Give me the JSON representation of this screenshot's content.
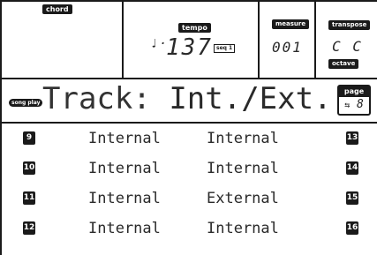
{
  "status": {
    "chord_label": "chord",
    "tempo_label": "tempo",
    "tempo_value": "137",
    "seq_badge": "seq 1",
    "measure_label": "measure",
    "measure_value": "001",
    "transpose_label": "transpose",
    "transpose_value": "C  C",
    "octave_label": "octave"
  },
  "title_bar": {
    "mode_pill": "song play",
    "title_prefix": "Track:",
    "title_value": "Int./Ext.",
    "page_label": "page",
    "page_value": "8"
  },
  "tracks": [
    {
      "left_num": "9",
      "left_val": "Internal",
      "right_val": "Internal",
      "right_num": "13"
    },
    {
      "left_num": "10",
      "left_val": "Internal",
      "right_val": "Internal",
      "right_num": "14"
    },
    {
      "left_num": "11",
      "left_val": "Internal",
      "right_val": "External",
      "right_num": "15"
    },
    {
      "left_num": "12",
      "left_val": "Internal",
      "right_val": "Internal",
      "right_num": "16"
    }
  ],
  "icons": {
    "note": "quarter-note-icon",
    "page_arrows": "page-arrows-icon"
  }
}
